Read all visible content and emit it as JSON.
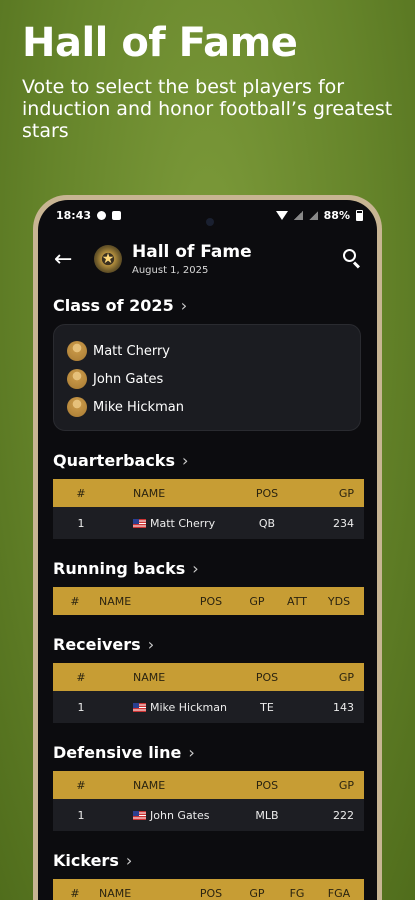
{
  "promo": {
    "title": "Hall of Fame",
    "subtitle": "Vote to select the best players for induction and honor football’s greatest stars"
  },
  "status_bar": {
    "time": "18:43",
    "battery": "88%"
  },
  "app_bar": {
    "title": "Hall of Fame",
    "date": "August 1, 2025"
  },
  "class_section": {
    "title": "Class of 2025",
    "members": [
      "Matt Cherry",
      "John Gates",
      "Mike Hickman"
    ]
  },
  "quarterbacks": {
    "title": "Quarterbacks",
    "columns": [
      "#",
      "NAME",
      "POS",
      "GP"
    ],
    "rows": [
      {
        "num": "1",
        "name": "Matt Cherry",
        "pos": "QB",
        "gp": "234"
      }
    ]
  },
  "running_backs": {
    "title": "Running backs",
    "columns": [
      "#",
      "NAME",
      "POS",
      "GP",
      "ATT",
      "YDS"
    ]
  },
  "receivers": {
    "title": "Receivers",
    "columns": [
      "#",
      "NAME",
      "POS",
      "GP"
    ],
    "rows": [
      {
        "num": "1",
        "name": "Mike Hickman",
        "pos": "TE",
        "gp": "143"
      }
    ]
  },
  "defensive_line": {
    "title": "Defensive line",
    "columns": [
      "#",
      "NAME",
      "POS",
      "GP"
    ],
    "rows": [
      {
        "num": "1",
        "name": "John Gates",
        "pos": "MLB",
        "gp": "222"
      }
    ]
  },
  "kickers": {
    "title": "Kickers",
    "columns": [
      "#",
      "NAME",
      "POS",
      "GP",
      "FG",
      "FGA"
    ]
  },
  "colors": {
    "background": "#65842a",
    "accent_gold": "#c79d34",
    "card": "#1b1c21"
  }
}
